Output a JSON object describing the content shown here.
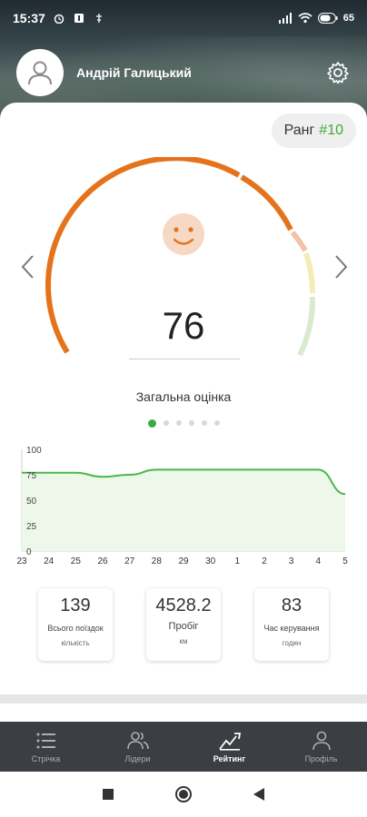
{
  "status_bar": {
    "time": "15:37",
    "battery": "65"
  },
  "header": {
    "user_name": "Андрій Галицький"
  },
  "rank": {
    "label": "Ранг",
    "value": "#10"
  },
  "score": {
    "value": "76",
    "caption": "Загальна оцінка",
    "pages": 6,
    "active_page": 0
  },
  "chart_data": {
    "type": "area",
    "x": [
      "23",
      "24",
      "25",
      "26",
      "27",
      "28",
      "29",
      "30",
      "1",
      "2",
      "3",
      "4",
      "5"
    ],
    "values": [
      77,
      77,
      77,
      73,
      75,
      80,
      80,
      80,
      80,
      80,
      80,
      80,
      56
    ],
    "ylim": [
      0,
      100
    ],
    "yticks": [
      "100",
      "75",
      "50",
      "25",
      "0"
    ],
    "colors": {
      "line": "#4ab84a",
      "fill": "#eef8ea"
    }
  },
  "stats": [
    {
      "value": "139",
      "label": "Всього поїздок",
      "sub": "кількість"
    },
    {
      "value": "4528.2",
      "label": "Пробіг",
      "sub": "км"
    },
    {
      "value": "83",
      "label": "Час керування",
      "sub": "годин"
    }
  ],
  "bottom_nav": [
    {
      "label": "Стрічка",
      "icon": "feed-icon"
    },
    {
      "label": "Лідери",
      "icon": "leaders-icon"
    },
    {
      "label": "Рейтинг",
      "icon": "rating-icon",
      "active": true
    },
    {
      "label": "Профіль",
      "icon": "profile-icon"
    }
  ],
  "colors": {
    "accent_green": "#3daa3d",
    "gauge_orange": "#e4731c",
    "face": "#f6d8c4"
  }
}
